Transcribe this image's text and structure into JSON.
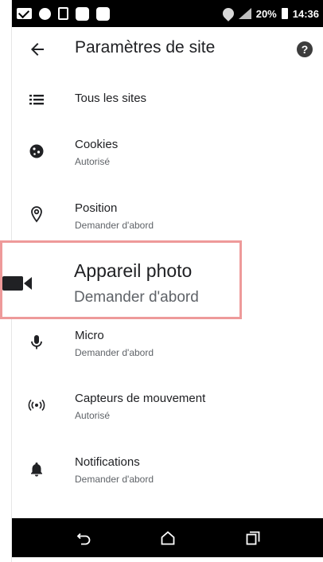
{
  "status_bar": {
    "battery_text": "20%",
    "time": "14:36"
  },
  "header": {
    "title": "Paramètres de site"
  },
  "list": [
    {
      "label": "Tous les sites",
      "sub": "",
      "icon": "list-icon"
    },
    {
      "label": "Cookies",
      "sub": "Autorisé",
      "icon": "cookie-icon"
    },
    {
      "label": "Position",
      "sub": "Demander d'abord",
      "icon": "location-pin-icon"
    },
    {
      "label": "Appareil photo",
      "sub": "Demander d'abord",
      "icon": "video-camera-icon"
    },
    {
      "label": "Micro",
      "sub": "Demander d'abord",
      "icon": "microphone-icon"
    },
    {
      "label": "Capteurs de mouvement",
      "sub": "Autorisé",
      "icon": "motion-sensor-icon"
    },
    {
      "label": "Notifications",
      "sub": "Demander d'abord",
      "icon": "bell-icon"
    }
  ],
  "navbar": {
    "icons": [
      "back-nav-icon",
      "home-nav-icon",
      "recents-nav-icon"
    ]
  },
  "colors": {
    "highlight_border": "#ee9a9a",
    "text_primary": "#202124",
    "text_secondary": "#5f6368"
  }
}
